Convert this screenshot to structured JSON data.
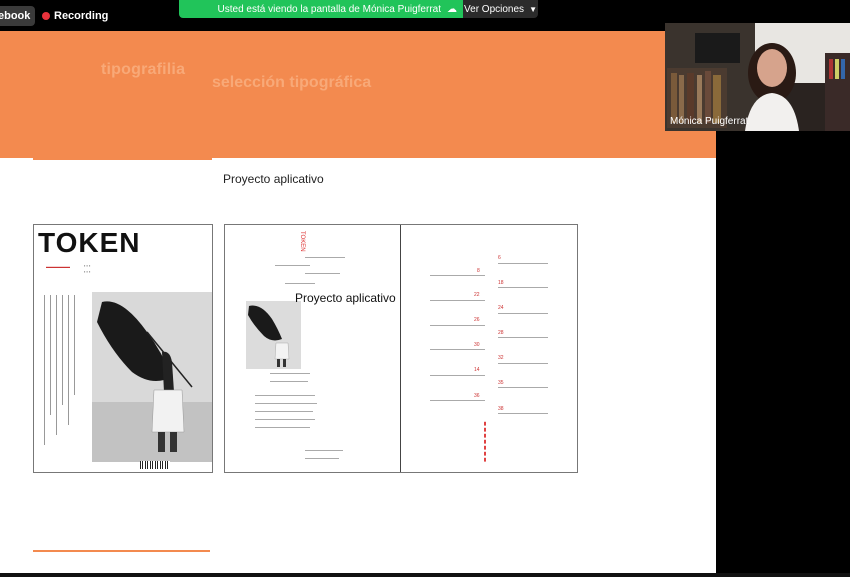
{
  "topbar": {
    "left_tab_label": "ebook",
    "recording_label": "Recording",
    "share_banner_text": "Usted está viendo la pantalla de Mónica Puigferrat",
    "options_label": "Ver Opciones",
    "colors": {
      "banner": "#21c45a",
      "record": "#e8323c"
    }
  },
  "slide": {
    "header_text_1": "tipografilia",
    "header_text_2": "selección tipográfica",
    "subtitle": "Proyecto aplicativo",
    "accent_color": "#f38a4f",
    "cover": {
      "logo": "TOKEN"
    },
    "spread": {
      "overlay_text": "Proyecto aplicativo",
      "toc_numbers": [
        "6",
        "8",
        "18",
        "22",
        "24",
        "26",
        "28",
        "30",
        "32",
        "14",
        "35",
        "36",
        "38"
      ]
    }
  },
  "webcam": {
    "participant_name": "Mónica Puigferrat"
  }
}
